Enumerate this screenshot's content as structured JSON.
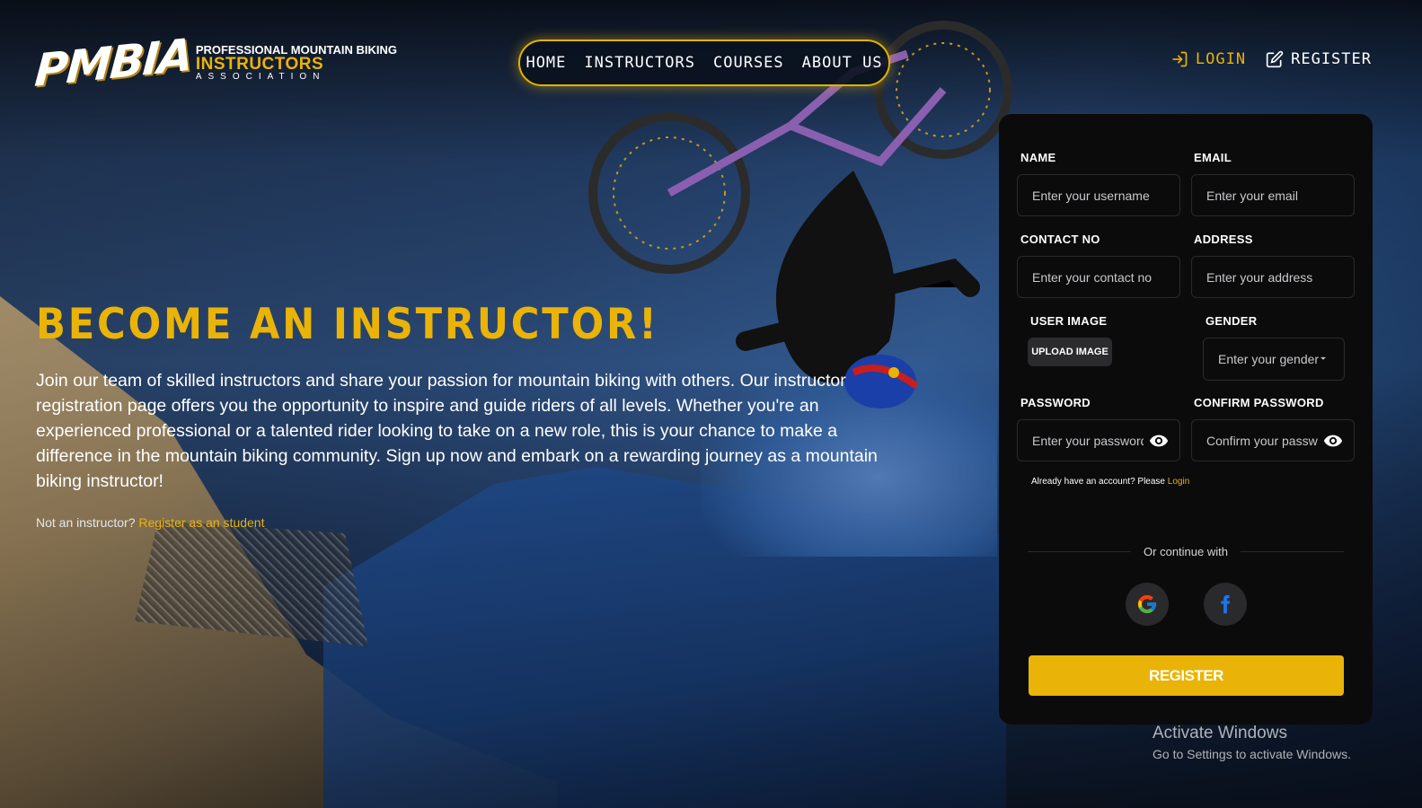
{
  "logo": {
    "mark": "PMBIA",
    "line1": "PROFESSIONAL MOUNTAIN BIKING",
    "line2": "INSTRUCTORS",
    "line3": "ASSOCIATION"
  },
  "nav": {
    "items": [
      {
        "label": "HOME"
      },
      {
        "label": "INSTRUCTORS"
      },
      {
        "label": "COURSES"
      },
      {
        "label": "ABOUT US"
      }
    ]
  },
  "auth": {
    "login_label": "LOGIN",
    "register_label": "REGISTER",
    "login_icon": "login-icon",
    "register_icon": "edit-icon"
  },
  "hero": {
    "title": "BECOME AN INSTRUCTOR!",
    "text": "Join our team of skilled instructors and share your passion for mountain biking with others. Our instructor registration page offers you the opportunity to inspire and guide riders of all levels. Whether you're an experienced professional or a talented rider looking to take on a new role, this is your chance to make a difference in the mountain biking community. Sign up now and embark on a rewarding journey as a mountain biking instructor!",
    "note_prefix": "Not an instructor?",
    "note_link": "Register as an student"
  },
  "form": {
    "name_label": "NAME",
    "name_placeholder": "Enter your username",
    "email_label": "EMAIL",
    "email_placeholder": "Enter your email",
    "contact_label": "CONTACT NO",
    "contact_placeholder": "Enter your contact no",
    "address_label": "ADDRESS",
    "address_placeholder": "Enter your address",
    "image_label": "USER IMAGE",
    "upload_label": "UPLOAD IMAGE",
    "gender_label": "GENDER",
    "gender_placeholder": "Enter your gender",
    "password_label": "PASSWORD",
    "password_placeholder": "Enter your password",
    "confirm_label": "CONFIRM PASSWORD",
    "confirm_placeholder": "Confirm your password",
    "already_text": "Already have an account? Please",
    "already_link": "Login",
    "continue_text": "Or continue with",
    "google_icon": "google-icon",
    "facebook_icon": "facebook-icon",
    "submit_label": "REGISTER"
  },
  "watermark": {
    "title": "Activate Windows",
    "subtitle": "Go to Settings to activate Windows."
  },
  "colors": {
    "accent": "#eab308",
    "card": "#0b0b0c",
    "nav_bg": "#0a121e"
  }
}
